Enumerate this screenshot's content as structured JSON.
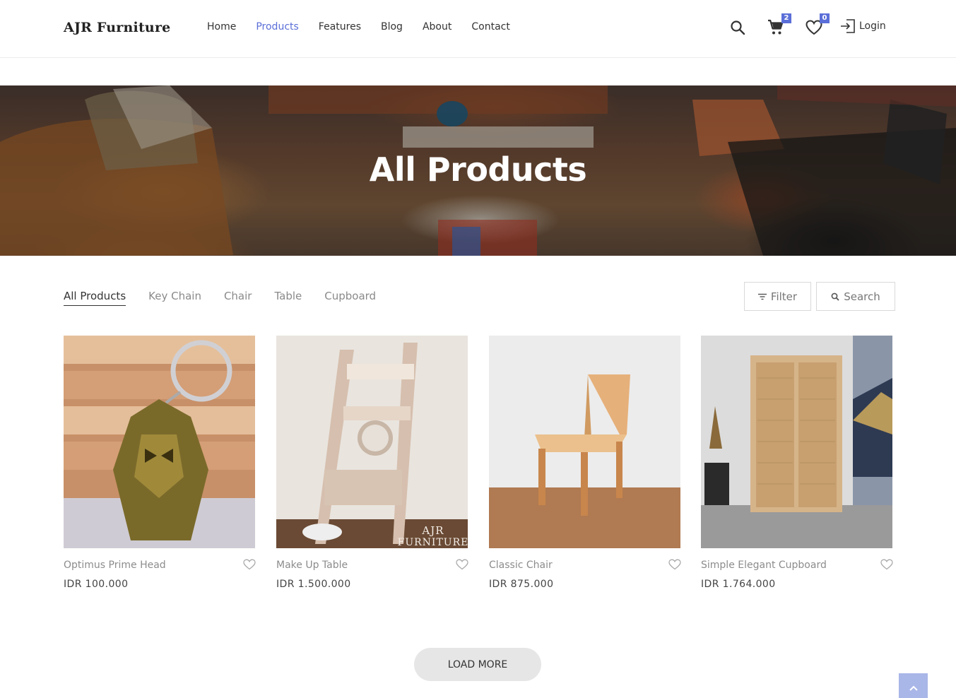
{
  "header": {
    "logo": "AJR Furniture",
    "nav": [
      "Home",
      "Products",
      "Features",
      "Blog",
      "About",
      "Contact"
    ],
    "active_nav": "Products",
    "cart_count": "2",
    "wishlist_count": "0",
    "login_label": "Login",
    "icons": [
      "search-icon",
      "cart-icon",
      "heart-icon",
      "login-icon"
    ]
  },
  "hero": {
    "title": "All Products"
  },
  "categories": [
    "All Products",
    "Key Chain",
    "Chair",
    "Table",
    "Cupboard"
  ],
  "active_category": "All Products",
  "tools": {
    "filter_label": "Filter",
    "search_label": "Search"
  },
  "products": [
    {
      "name": "Optimus Prime Head",
      "price": "IDR 100.000"
    },
    {
      "name": "Make Up Table",
      "price": "IDR 1.500.000",
      "watermark": "AJR FURNITURE"
    },
    {
      "name": "Classic Chair",
      "price": "IDR 875.000"
    },
    {
      "name": "Simple Elegant Cupboard",
      "price": "IDR 1.764.000"
    }
  ],
  "load_more_label": "LOAD MORE",
  "colors": {
    "accent": "#5b6fd8",
    "scroll_top_bg": "#a9b6e8"
  }
}
